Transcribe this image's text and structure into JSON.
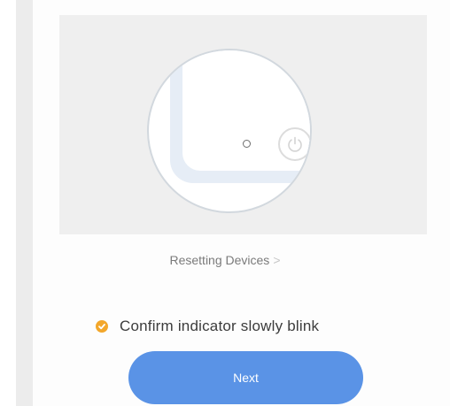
{
  "reset": {
    "link_label": "Resetting Devices",
    "chevron": ">"
  },
  "confirm": {
    "label": "Confirm indicator slowly blink",
    "icon": "check-circle-icon",
    "icon_color": "#f3a72b"
  },
  "next_button": {
    "label": "Next",
    "color": "#5a93e6"
  },
  "illustration": {
    "background_color": "#efefef",
    "icons": [
      "indicator-light-icon",
      "power-icon"
    ]
  }
}
